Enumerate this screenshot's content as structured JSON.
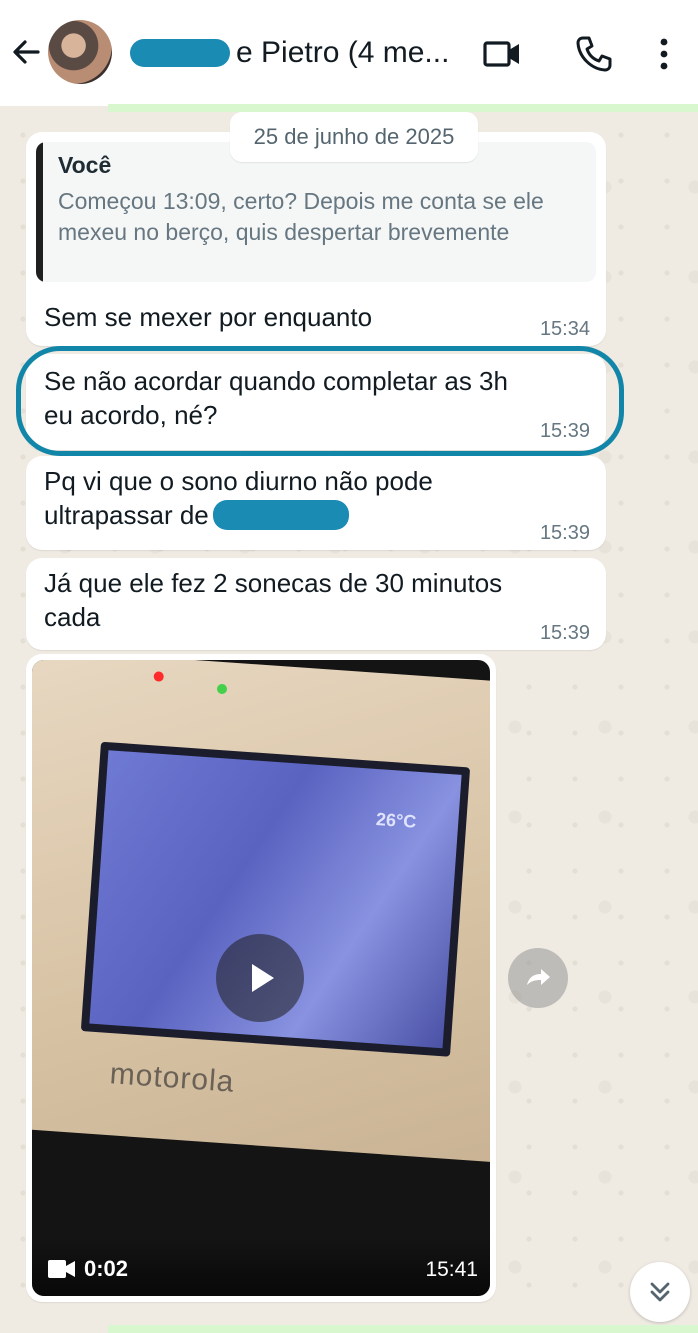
{
  "header": {
    "title_suffix": "e Pietro (4 me...",
    "back_icon": "arrow-left-icon",
    "video_call_icon": "video-camera-icon",
    "voice_call_icon": "phone-icon",
    "menu_icon": "more-vertical-icon"
  },
  "chat": {
    "date_chip": "25 de junho de 2025",
    "messages": [
      {
        "quote_author": "Você",
        "quote_text": "Começou 13:09, certo? Depois me conta se ele mexeu no berço, quis despertar brevemente",
        "text": "Sem se mexer por enquanto",
        "time": "15:34"
      },
      {
        "text_line1": "Se não acordar quando completar as 3h",
        "text_line2": "eu acordo, né?",
        "time": "15:39"
      },
      {
        "text_line1": "Pq vi que o sono diurno não pode",
        "text_line2": "ultrapassar de",
        "time": "15:39"
      },
      {
        "text_line1": "Já que ele fez 2 sonecas de 30 minutos",
        "text_line2": "cada",
        "time": "15:39"
      }
    ],
    "video": {
      "duration": "0:02",
      "time": "15:41",
      "monitor_brand": "motorola",
      "monitor_temp": "26°C"
    }
  },
  "colors": {
    "highlight": "#1186a8",
    "redaction": "#1a8bb3",
    "chat_bg": "#efeae2",
    "bubble_bg": "#ffffff"
  }
}
